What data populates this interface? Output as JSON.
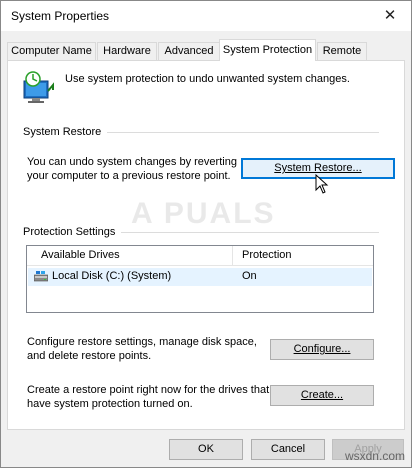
{
  "window": {
    "title": "System Properties",
    "close_glyph": "✕"
  },
  "tabs": [
    {
      "label": "Computer Name",
      "active": false
    },
    {
      "label": "Hardware",
      "active": false
    },
    {
      "label": "Advanced",
      "active": false
    },
    {
      "label": "System Protection",
      "active": true
    },
    {
      "label": "Remote",
      "active": false
    }
  ],
  "intro": {
    "icon": "system-protection-icon",
    "text": "Use system protection to undo unwanted system changes."
  },
  "system_restore": {
    "group_label": "System Restore",
    "description_line1": "You can undo system changes by reverting",
    "description_line2": "your computer to a previous restore point.",
    "button_label": "System Restore..."
  },
  "protection_settings": {
    "group_label": "Protection Settings",
    "columns": [
      "Available Drives",
      "Protection"
    ],
    "drives": [
      {
        "icon": "local-disk-icon",
        "name": "Local Disk (C:) (System)",
        "protection": "On"
      }
    ]
  },
  "configure": {
    "description_line1": "Configure restore settings, manage disk space,",
    "description_line2": "and delete restore points.",
    "button_label": "Configure..."
  },
  "create": {
    "description_line1": "Create a restore point right now for the drives that",
    "description_line2": "have system protection turned on.",
    "button_label": "Create..."
  },
  "footer": {
    "ok_label": "OK",
    "cancel_label": "Cancel",
    "apply_label": "Apply"
  },
  "watermarks": {
    "center": "A PUALS",
    "corner": "wsxdn.com"
  },
  "colors": {
    "accent": "#0078d7",
    "selection": "#e5f3ff"
  }
}
